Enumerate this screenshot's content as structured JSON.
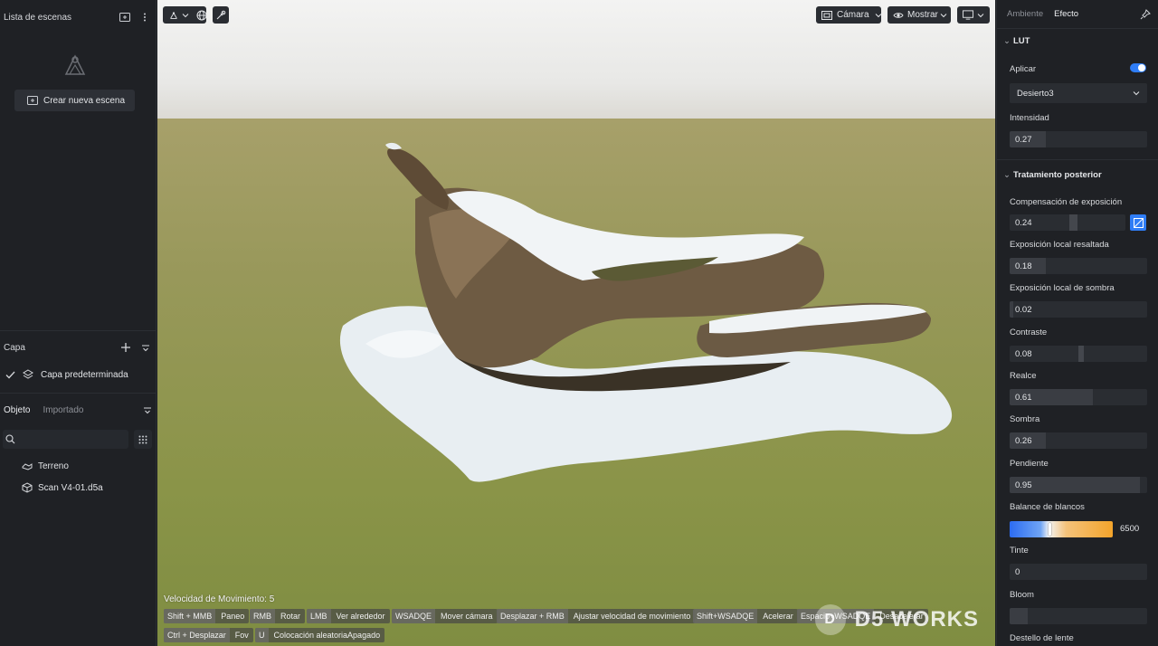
{
  "left": {
    "scene_list_title": "Lista de escenas",
    "create_scene_label": "Crear nueva escena",
    "layer_title": "Capa",
    "default_layer": "Capa predeterminada",
    "object_tab": "Objeto",
    "imported_tab": "Importado",
    "search_placeholder": "",
    "objects": [
      {
        "label": "Terreno",
        "icon": "terrain-icon"
      },
      {
        "label": "Scan V4-01.d5a",
        "icon": "cube-icon"
      }
    ]
  },
  "viewport": {
    "camera_label": "Cámara",
    "show_label": "Mostrar",
    "speed_text": "Velocidad de Movimiento: 5",
    "hints_row1": [
      {
        "key": "Shift + MMB",
        "action": "Paneo"
      },
      {
        "key": "RMB",
        "action": "Rotar"
      },
      {
        "key": "LMB",
        "action": "Ver alrededor"
      },
      {
        "key": "WSADQE",
        "action": "Mover cámara"
      },
      {
        "key": "Desplazar + RMB",
        "action": "Ajustar velocidad de movimiento"
      },
      {
        "key": "Shift+WSADQE",
        "action": "Acelerar"
      },
      {
        "key": "Espacio+WSADQE",
        "action": "Desacelerar"
      }
    ],
    "hints_row2": [
      {
        "key": "Ctrl + Desplazar",
        "action": "Fov"
      },
      {
        "key": "U",
        "action": "Colocación aleatoriaApagado"
      }
    ],
    "watermark": "D5 WORKS"
  },
  "right": {
    "tabs": {
      "ambiente": "Ambiente",
      "efecto": "Efecto"
    },
    "lut": {
      "title": "LUT",
      "apply_label": "Aplicar",
      "apply_on": true,
      "preset": "Desierto3",
      "intensity_label": "Intensidad",
      "intensity": "0.27"
    },
    "post": {
      "title": "Tratamiento posterior",
      "exposure_label": "Compensación de exposición",
      "exposure": "0.24",
      "local_high_label": "Exposición local resaltada",
      "local_high": "0.18",
      "local_shadow_label": "Exposición local de sombra",
      "local_shadow": "0.02",
      "contrast_label": "Contraste",
      "contrast": "0.08",
      "highlight_label": "Realce",
      "highlight": "0.61",
      "shadow_label": "Sombra",
      "shadow": "0.26",
      "slope_label": "Pendiente",
      "slope": "0.95",
      "wb_label": "Balance de blancos",
      "wb": "6500",
      "tint_label": "Tinte",
      "tint": "0",
      "bloom_label": "Bloom",
      "flare_label": "Destello de lente"
    },
    "accent_color": "#2f7df6"
  }
}
